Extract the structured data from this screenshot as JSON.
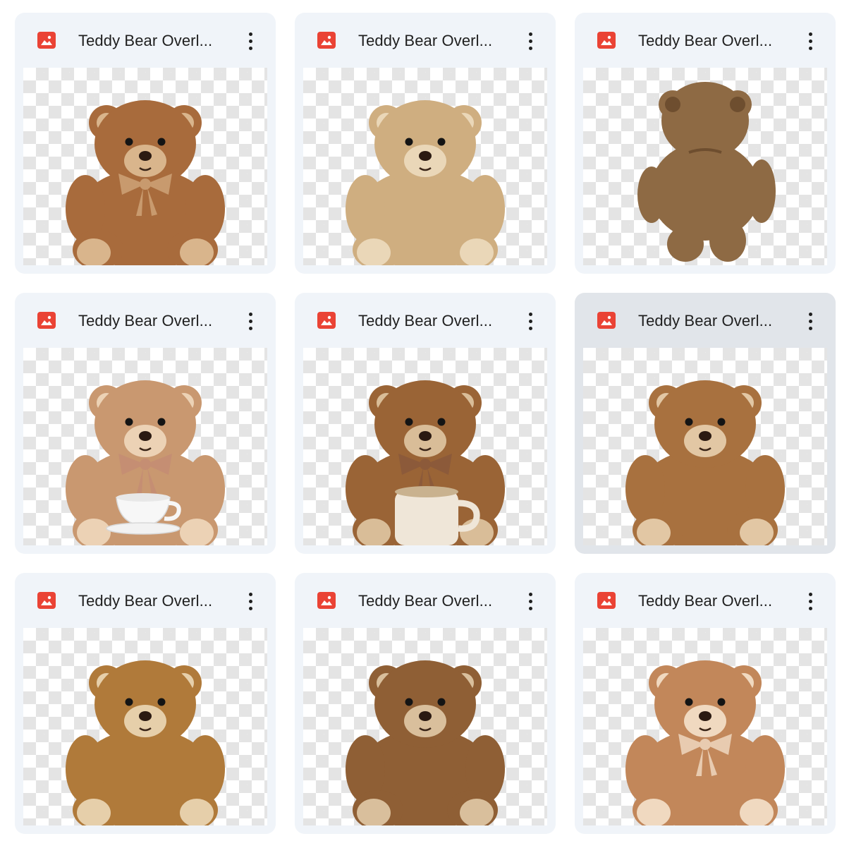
{
  "files": [
    {
      "title": "Teddy Bear Overl...",
      "icon": "image-file-icon",
      "bear": {
        "fur": "#a86b3c",
        "light": "#d9b58c",
        "cup": false,
        "back": false,
        "ribbon": true,
        "ribbonColor": "#c89a6e"
      }
    },
    {
      "title": "Teddy Bear Overl...",
      "icon": "image-file-icon",
      "bear": {
        "fur": "#cfae80",
        "light": "#ead7b8",
        "cup": false,
        "back": false,
        "ribbon": false
      }
    },
    {
      "title": "Teddy Bear Overl...",
      "icon": "image-file-icon",
      "bear": {
        "fur": "#8e6a44",
        "light": "#b08a5e",
        "cup": false,
        "back": true,
        "ribbon": false
      }
    },
    {
      "title": "Teddy Bear Overl...",
      "icon": "image-file-icon",
      "bear": {
        "fur": "#c99870",
        "light": "#ecd2b5",
        "cup": true,
        "cupStyle": "teacup",
        "back": false,
        "ribbon": true,
        "ribbonColor": "#c58e73"
      }
    },
    {
      "title": "Teddy Bear Overl...",
      "icon": "image-file-icon",
      "bear": {
        "fur": "#9a6436",
        "light": "#d9bd98",
        "cup": true,
        "cupStyle": "mug",
        "back": false,
        "ribbon": true,
        "ribbonColor": "#8c5a3a"
      }
    },
    {
      "title": "Teddy Bear Overl...",
      "icon": "image-file-icon",
      "selected": true,
      "bear": {
        "fur": "#a8713f",
        "light": "#e2c7a4",
        "cup": false,
        "back": false,
        "ribbon": false
      }
    },
    {
      "title": "Teddy Bear Overl...",
      "icon": "image-file-icon",
      "bear": {
        "fur": "#b07a3a",
        "light": "#e6cfaa",
        "cup": false,
        "back": false,
        "ribbon": false
      }
    },
    {
      "title": "Teddy Bear Overl...",
      "icon": "image-file-icon",
      "bear": {
        "fur": "#8f5f35",
        "light": "#d9bf9c",
        "cup": false,
        "back": false,
        "ribbon": false
      }
    },
    {
      "title": "Teddy Bear Overl...",
      "icon": "image-file-icon",
      "bear": {
        "fur": "#c2875a",
        "light": "#f0d9c0",
        "cup": false,
        "back": false,
        "ribbon": true,
        "ribbonColor": "#e8cbb0"
      }
    }
  ],
  "colors": {
    "icon": "#ea4335",
    "card": "#f0f4f9",
    "cardSelected": "#e1e5ea",
    "text": "#1f1f1f"
  }
}
